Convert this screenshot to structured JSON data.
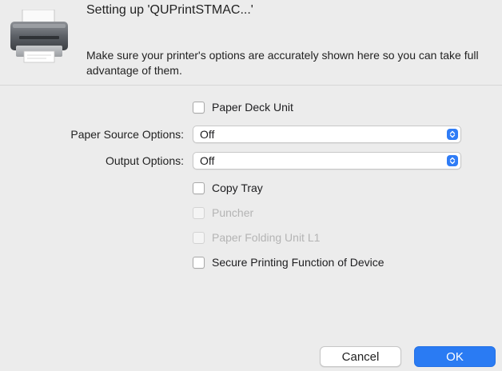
{
  "dialog": {
    "title": "Setting up 'QUPrintSTMAC...'",
    "description": "Make sure your printer's options are accurately shown here so you can take full advantage of them.",
    "icon": "printer-icon"
  },
  "options": {
    "paper_deck_unit": {
      "label": "Paper Deck Unit",
      "checked": false,
      "enabled": true
    },
    "paper_source": {
      "label": "Paper Source Options:",
      "value": "Off"
    },
    "output": {
      "label": "Output Options:",
      "value": "Off"
    },
    "copy_tray": {
      "label": "Copy Tray",
      "checked": false,
      "enabled": true
    },
    "puncher": {
      "label": "Puncher",
      "checked": false,
      "enabled": false
    },
    "paper_folding_unit": {
      "label": "Paper Folding Unit L1",
      "checked": false,
      "enabled": false
    },
    "secure_printing": {
      "label": "Secure Printing Function of Device",
      "checked": false,
      "enabled": true
    }
  },
  "buttons": {
    "cancel": "Cancel",
    "ok": "OK"
  },
  "colors": {
    "accent": "#2a7bf3",
    "background": "#ececec",
    "disabled_text": "#b4b4b4"
  }
}
